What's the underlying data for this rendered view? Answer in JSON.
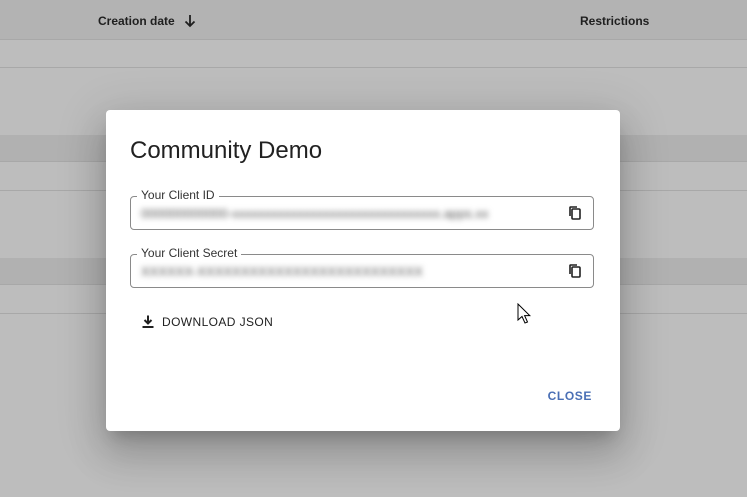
{
  "background_table": {
    "columns": [
      {
        "label": "Creation date",
        "sort": "descending"
      },
      {
        "label": "Restrictions"
      }
    ]
  },
  "dialog": {
    "title": "Community Demo",
    "client_id": {
      "label": "Your Client ID",
      "value": "000000000000-xxxxxxxxxxxxxxxxxxxxxxxxxxxxxxxx.apps.xx"
    },
    "client_secret": {
      "label": "Your Client Secret",
      "value": "XXXXXX-XXXXXXXXXXXXXXXXXXXXXXXXXX"
    },
    "download_label": "DOWNLOAD JSON",
    "close_label": "CLOSE"
  },
  "icons": {
    "sort": "arrow-down-icon",
    "copy": "copy-icon",
    "download": "download-icon",
    "cursor": "mouse-pointer-icon"
  },
  "colors": {
    "overlay": "#bdbdbd",
    "accent": "#4a6fb5",
    "text": "#212121"
  }
}
